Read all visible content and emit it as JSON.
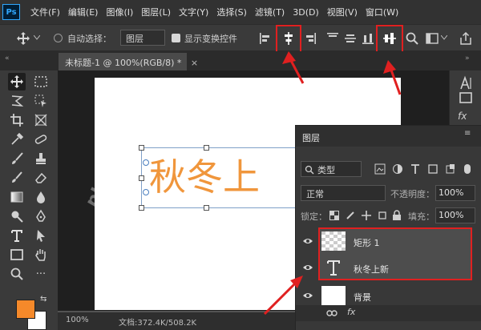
{
  "app": {
    "logo": "Ps"
  },
  "menu": [
    "文件(F)",
    "编辑(E)",
    "图像(I)",
    "图层(L)",
    "文字(Y)",
    "选择(S)",
    "滤镜(T)",
    "3D(D)",
    "视图(V)",
    "窗口(W)"
  ],
  "options": {
    "auto_select_label": "自动选择：",
    "auto_select_value": "图层",
    "show_transform_label": "显示变换控件"
  },
  "document": {
    "tab_title": "未标题-1 @ 100%(RGB/8) *",
    "zoom": "100%",
    "doc_size": "文档:372.4K/508.2K",
    "canvas_text": "秋冬上"
  },
  "layers_panel": {
    "title": "图层",
    "filter_label": "类型",
    "blend_mode": "正常",
    "opacity_label": "不透明度：",
    "opacity_value": "100%",
    "lock_label": "锁定：",
    "fill_label": "填充：",
    "fill_value": "100%",
    "layers": [
      {
        "name": "矩形 1",
        "type": "shape"
      },
      {
        "name": "秋冬上新",
        "type": "text"
      },
      {
        "name": "背景",
        "type": "background"
      }
    ],
    "footer_fx": "fx"
  },
  "colors": {
    "foreground": "#f5892a",
    "background": "#ffffff",
    "annotation": "#e02020",
    "text_orange": "#f0963c",
    "selection_blue": "#4a7fc0"
  },
  "watermark": "php.cn"
}
